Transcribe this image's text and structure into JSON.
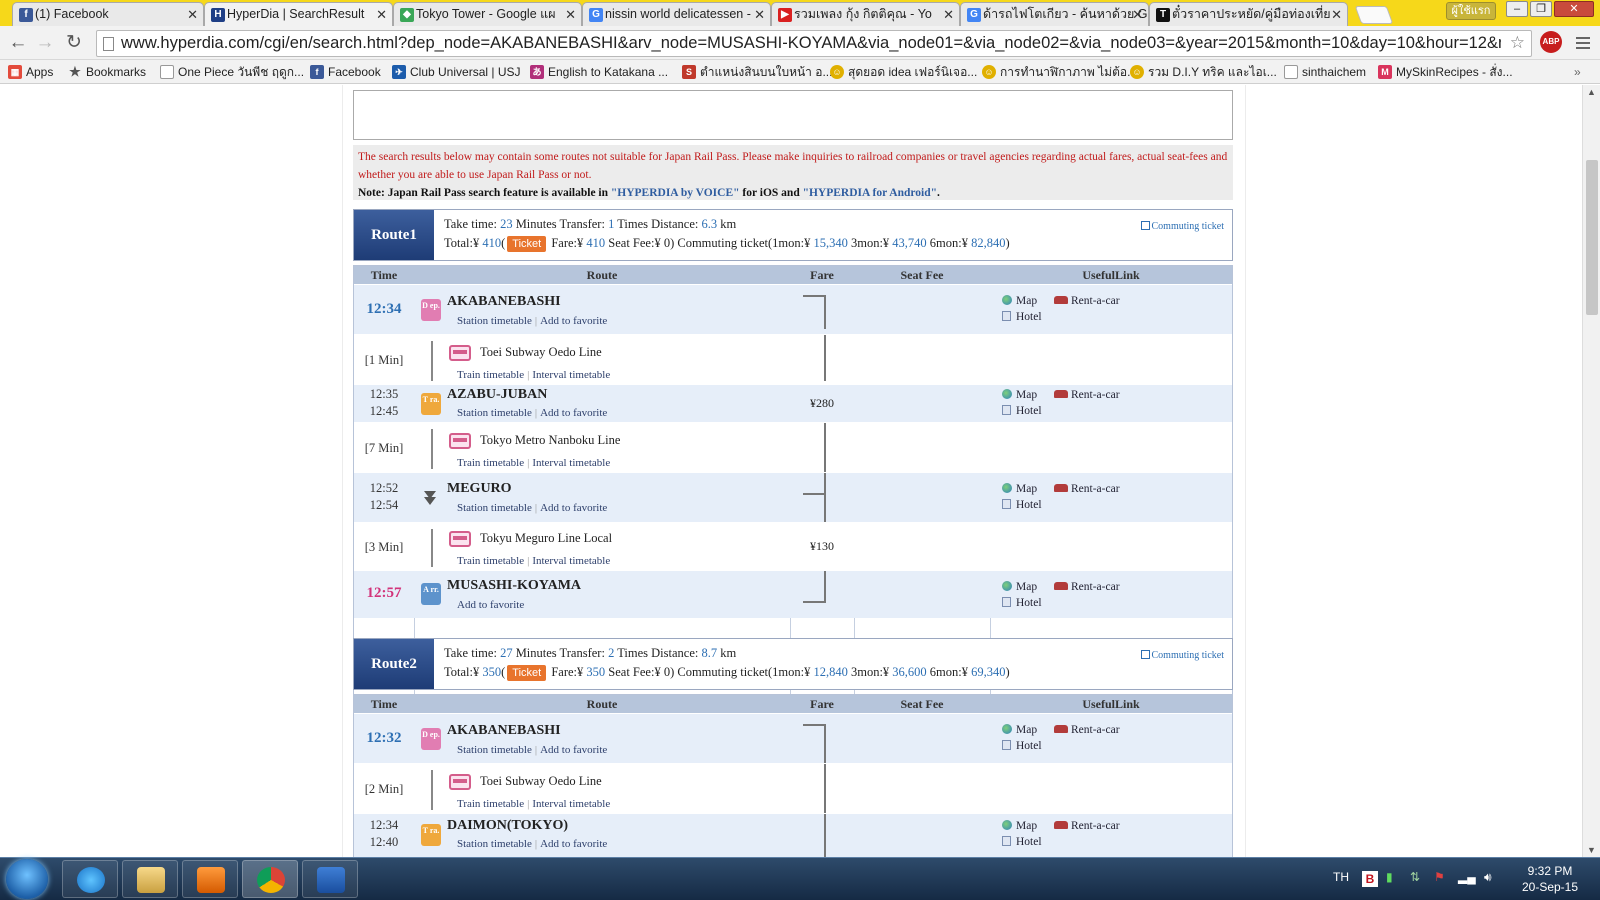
{
  "browser": {
    "tabs": [
      {
        "title": "(1) Facebook",
        "icon": "facebook-icon",
        "color": "#3b5998",
        "glyph": "f"
      },
      {
        "title": "HyperDia | SearchResult",
        "icon": "hyperdia-icon",
        "color": "#1f3f86",
        "glyph": "H"
      },
      {
        "title": "Tokyo Tower - Google แผ",
        "icon": "google-maps-icon",
        "color": "#3aa757",
        "glyph": "◆"
      },
      {
        "title": "nissin world delicatessen -",
        "icon": "google-icon",
        "color": "#4285f4",
        "glyph": "G"
      },
      {
        "title": "รวมเพลง กุ้ง กิตติคุณ - Yo",
        "icon": "youtube-icon",
        "color": "#d92020",
        "glyph": "▶"
      },
      {
        "title": "ด้ารถไฟโตเกียว - ค้นหาด้วย G",
        "icon": "google-icon",
        "color": "#4285f4",
        "glyph": "G"
      },
      {
        "title": "ตั๋วราคาประหยัด/คู่มือท่องเที่ย",
        "icon": "t-site-icon",
        "color": "#111111",
        "glyph": "T"
      }
    ],
    "user_button": "ผู้ใช้แรก",
    "url": "www.hyperdia.com/cgi/en/search.html?dep_node=AKABANEBASHI&arv_node=MUSASHI-KOYAMA&via_node01=&via_node02=&via_node03=&year=2015&month=10&day=10&hour=12&minute",
    "abp_badge": "ABP",
    "bookmarks": [
      {
        "label": "Apps",
        "icon": "apps-icon",
        "color": "#e34b3c"
      },
      {
        "label": "Bookmarks",
        "icon": "star-icon",
        "color": "#555555"
      },
      {
        "label": "One Piece วันพีช ฤดูก...",
        "icon": "page-icon",
        "color": "#9aa0a6"
      },
      {
        "label": "Facebook",
        "icon": "facebook-icon",
        "color": "#3b5998"
      },
      {
        "label": "Club Universal | USJ",
        "icon": "usj-icon",
        "color": "#1c5cab"
      },
      {
        "label": "English to Katakana ...",
        "icon": "katakana-icon",
        "color": "#b12f7a"
      },
      {
        "label": "ตำแหน่งสินบนใบหน้า อ...",
        "icon": "site-icon",
        "color": "#c0392b"
      },
      {
        "label": "สุดยอด idea เฟอร์นิเจอ...",
        "icon": "smiley-icon",
        "color": "#e0b000"
      },
      {
        "label": "การทำนาฬิกาภาพ ไม่ต้อ...",
        "icon": "smiley-icon",
        "color": "#e0b000"
      },
      {
        "label": "รวม D.I.Y ทริค และไอเ...",
        "icon": "smiley-icon",
        "color": "#e0b000"
      },
      {
        "label": "sinthaichem",
        "icon": "page-icon",
        "color": "#9aa0a6"
      },
      {
        "label": "MySkinRecipes - สั่ง...",
        "icon": "myskin-icon",
        "color": "#d9345c"
      }
    ]
  },
  "notice": {
    "red": "The search results below may contain some routes not suitable for Japan Rail Pass. Please make inquiries to railroad companies or travel agencies regarding actual fares, actual seat-fees and whether you are able to use Japan Rail Pass or not.",
    "note_prefix": "Note: Japan Rail Pass search feature is available in ",
    "link_voice": "\"HYPERDIA by VOICE\"",
    "note_mid": " for iOS and ",
    "link_android": "\"HYPERDIA for Android\"",
    "note_end": "."
  },
  "table_headers": {
    "time": "Time",
    "route": "Route",
    "fare": "Fare",
    "seat_fee": "Seat Fee",
    "useful": "UsefulLink"
  },
  "links": {
    "station_timetable": "Station timetable",
    "add_favorite": "Add to favorite",
    "train_timetable": "Train timetable",
    "interval_timetable": "Interval timetable",
    "map": "Map",
    "rent_a_car": "Rent-a-car",
    "hotel": "Hotel",
    "commuting": "Commuting ticket",
    "ticket": "Ticket",
    "sep": "|"
  },
  "icon_labels": {
    "dep": "D ep.",
    "tra": "T ra.",
    "arr": "A rr."
  },
  "route1": {
    "label": "Route1",
    "take_time_label": "Take time: ",
    "take_time": "23",
    "minutes": " Minutes  Transfer: ",
    "transfer": "1",
    "times": " Times  Distance: ",
    "distance": "6.3",
    "km": " km",
    "total_label": "Total:¥ ",
    "total": "410",
    "fare_label": " Fare:¥ ",
    "fare": "410",
    "seat_label": "  Seat Fee:¥ ",
    "seat": "0",
    "commute_prefix": ")  Commuting ticket(1mon:¥ ",
    "c1": "15,340",
    "c3_label": "  3mon:¥ ",
    "c3": "43,740",
    "c6_label": "  6mon:¥ ",
    "c6": "82,840",
    "close": ")",
    "stops": [
      {
        "time": "12:34",
        "name": "AKABANEBASHI"
      },
      {
        "duration": "[1 Min]",
        "line": "Toei Subway Oedo Line"
      },
      {
        "time_arr": "12:35",
        "time_dep": "12:45",
        "name": "AZABU-JUBAN",
        "fare": "¥280"
      },
      {
        "duration": "[7 Min]",
        "line": "Tokyo Metro Nanboku Line"
      },
      {
        "time_arr": "12:52",
        "time_dep": "12:54",
        "name": "MEGURO"
      },
      {
        "duration": "[3 Min]",
        "line": "Tokyu Meguro Line Local",
        "fare": "¥130"
      },
      {
        "time": "12:57",
        "name": "MUSASHI-KOYAMA"
      }
    ]
  },
  "route2": {
    "label": "Route2",
    "take_time": "27",
    "transfer": "2",
    "distance": "8.7",
    "total": "350",
    "fare": "350",
    "seat": "0",
    "commute_prefix": ")  Commuting ticket(1mon:¥ ",
    "c1": "12,840",
    "c3": "36,600",
    "c6": "69,340",
    "stops": [
      {
        "time": "12:32",
        "name": "AKABANEBASHI"
      },
      {
        "duration": "[2 Min]",
        "line": "Toei Subway Oedo Line"
      },
      {
        "time_arr": "12:34",
        "time_dep": "12:40",
        "name": "DAIMON(TOKYO)"
      }
    ]
  },
  "taskbar": {
    "lang": "TH",
    "time": "9:32 PM",
    "date": "20-Sep-15"
  }
}
